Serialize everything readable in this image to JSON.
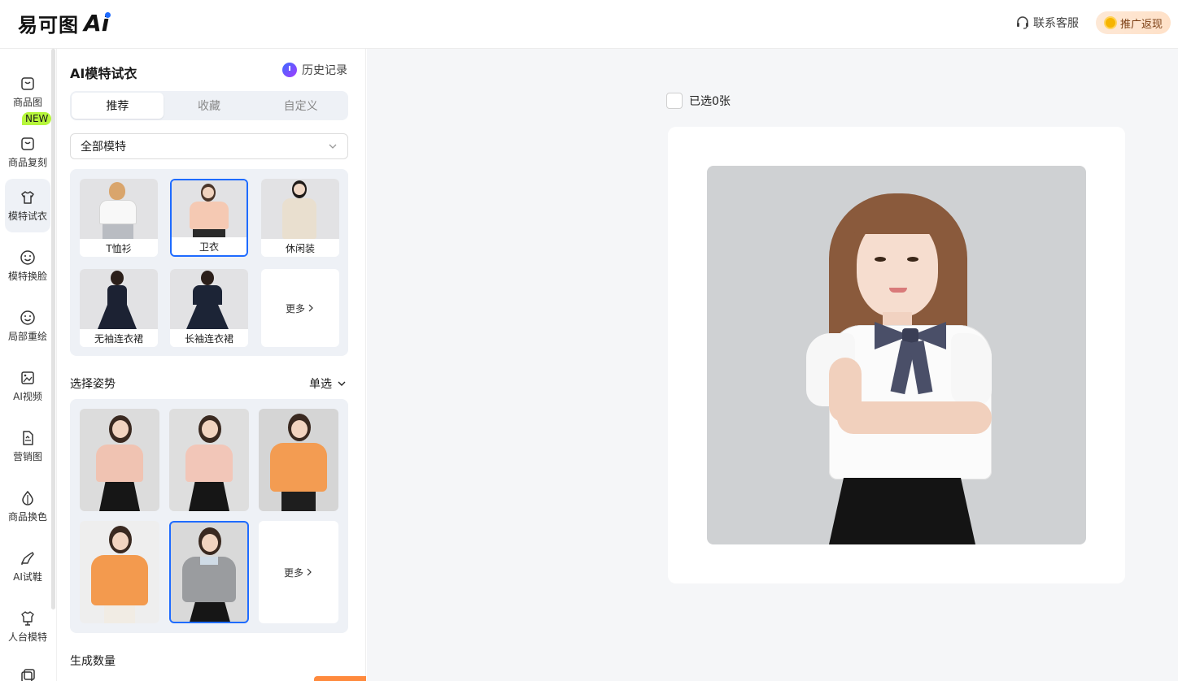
{
  "header": {
    "logo_text": "易可图",
    "logo_ai": "Ai",
    "contact_label": "联系客服",
    "promo_label": "推广返现"
  },
  "nav": {
    "items": [
      {
        "label": "商品图",
        "icon": "shopping-bag-icon"
      },
      {
        "label": "商品复刻",
        "icon": "copy-bag-icon",
        "badge": "NEW"
      },
      {
        "label": "模特试衣",
        "icon": "shirt-icon",
        "active": true
      },
      {
        "label": "模特换脸",
        "icon": "face-icon"
      },
      {
        "label": "局部重绘",
        "icon": "face-brush-icon"
      },
      {
        "label": "AI视频",
        "icon": "video-icon"
      },
      {
        "label": "营销图",
        "icon": "poster-icon"
      },
      {
        "label": "商品换色",
        "icon": "color-drop-icon"
      },
      {
        "label": "AI试鞋",
        "icon": "heel-shoe-icon"
      },
      {
        "label": "人台模特",
        "icon": "mannequin-icon"
      }
    ]
  },
  "panel": {
    "title": "AI模特试衣",
    "history_label": "历史记录",
    "tabs": [
      {
        "label": "推荐",
        "active": true
      },
      {
        "label": "收藏"
      },
      {
        "label": "自定义"
      }
    ],
    "model_filter": "全部模特",
    "categories": [
      {
        "label": "T恤衫",
        "color": "#f1f1f1"
      },
      {
        "label": "卫衣",
        "color": "#f5c9b3",
        "selected": true
      },
      {
        "label": "休闲装",
        "color": "#e9dfcf"
      },
      {
        "label": "无袖连衣裙",
        "color": "#1c2233"
      },
      {
        "label": "长袖连衣裙",
        "color": "#1c2436"
      }
    ],
    "category_more": "更多",
    "pose_title": "选择姿势",
    "pose_mode": "单选",
    "poses": [
      {
        "top_color": "#f0c3b2"
      },
      {
        "top_color": "#f2c6b8"
      },
      {
        "top_color": "#f39c52"
      },
      {
        "top_color": "#f39a4e"
      },
      {
        "top_color": "#9a9c9f",
        "selected": true
      }
    ],
    "pose_more": "更多",
    "count_title": "生成数量"
  },
  "main": {
    "selected_label": "已选0张"
  }
}
